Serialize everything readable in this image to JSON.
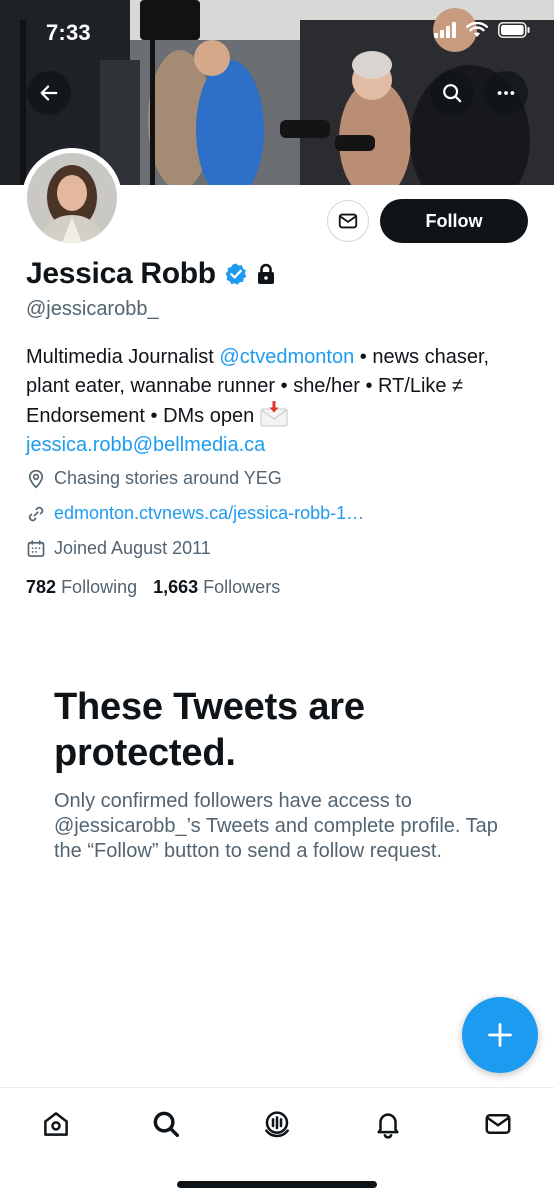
{
  "status_bar": {
    "time": "7:33"
  },
  "profile": {
    "display_name": "Jessica Robb",
    "handle": "@jessicarobb_",
    "verified": true,
    "protected": true,
    "bio": {
      "part1": "Multimedia Journalist ",
      "mention": "@ctvedmonton",
      "part2": " • news chaser, plant eater, wannabe runner • she/her • RT/Like ≠ Endorsement • DMs open ",
      "email": "jessica.robb@bellmedia.ca"
    },
    "location": "Chasing stories around YEG",
    "website": "edmonton.ctvnews.ca/jessica-robb-1…",
    "joined": "Joined August 2011",
    "following_count": "782",
    "following_label": "Following",
    "followers_count": "1,663",
    "followers_label": "Followers"
  },
  "actions": {
    "follow_label": "Follow"
  },
  "protected_notice": {
    "title": "These Tweets are protected.",
    "body": "Only confirmed followers have access to @jessicarobb_’s Tweets and complete profile. Tap the “Follow” button to send a follow request."
  },
  "icons": {
    "back": "back-arrow-icon",
    "search": "search-icon",
    "more": "more-icon",
    "message": "envelope-icon",
    "verified": "verified-badge-icon",
    "lock": "lock-icon",
    "location": "location-pin-icon",
    "link": "link-icon",
    "calendar": "calendar-icon",
    "compose": "plus-icon",
    "nav": [
      "home-icon",
      "search-icon",
      "spaces-icon",
      "notifications-icon",
      "messages-icon"
    ]
  },
  "colors": {
    "accent": "#1d9bf0",
    "text": "#0f1419",
    "secondary": "#536471"
  }
}
